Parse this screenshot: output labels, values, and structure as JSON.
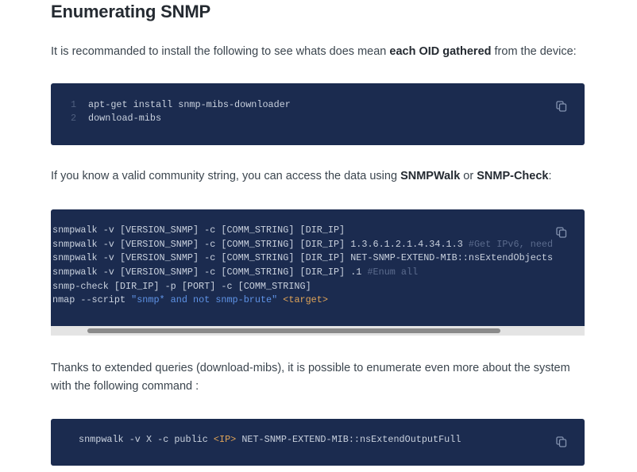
{
  "heading": "Enumerating SNMP",
  "intro": {
    "pre": "It is recommanded to install the following to see whats does mean ",
    "bold": "each OID gathered",
    "post": " from the device:"
  },
  "block1": {
    "lines": [
      {
        "num": "1",
        "code": "apt-get install snmp-mibs-downloader"
      },
      {
        "num": "2",
        "code": "download-mibs"
      }
    ]
  },
  "para2": {
    "pre": "If you know a valid community string, you can access the data using ",
    "bold1": "SNMPWalk",
    "mid": " or ",
    "bold2": "SNMP-Check",
    "post": ":"
  },
  "block2": {
    "line1": "snmpwalk -v [VERSION_SNMP] -c [COMM_STRING] [DIR_IP]",
    "line2_code": "snmpwalk -v [VERSION_SNMP] -c [COMM_STRING] [DIR_IP] 1.3.6.1.2.1.4.34.1.3 ",
    "line2_comment": "#Get IPv6, need",
    "line3": "snmpwalk -v [VERSION_SNMP] -c [COMM_STRING] [DIR_IP] NET-SNMP-EXTEND-MIB::nsExtendObjects",
    "line4_code": "snmpwalk -v [VERSION_SNMP] -c [COMM_STRING] [DIR_IP] .1 ",
    "line4_comment": "#Enum all",
    "line5": "snmp-check [DIR_IP] -p [PORT] -c [COMM_STRING]",
    "line6_pre": "nmap --script ",
    "line6_string": "\"snmp* and not snmp-brute\"",
    "line6_space": " ",
    "line6_target": "<target>"
  },
  "para3": {
    "line1": "Thanks to extended queries (download-mibs), it is possible to enumerate even more about the system",
    "line2": "with the following command :"
  },
  "block3": {
    "pre": "snmpwalk -v X -c public ",
    "ip": "<IP>",
    "post": " NET-SNMP-EXTEND-MIB::nsExtendOutputFull"
  },
  "icons": {
    "copy": "copy-icon"
  }
}
